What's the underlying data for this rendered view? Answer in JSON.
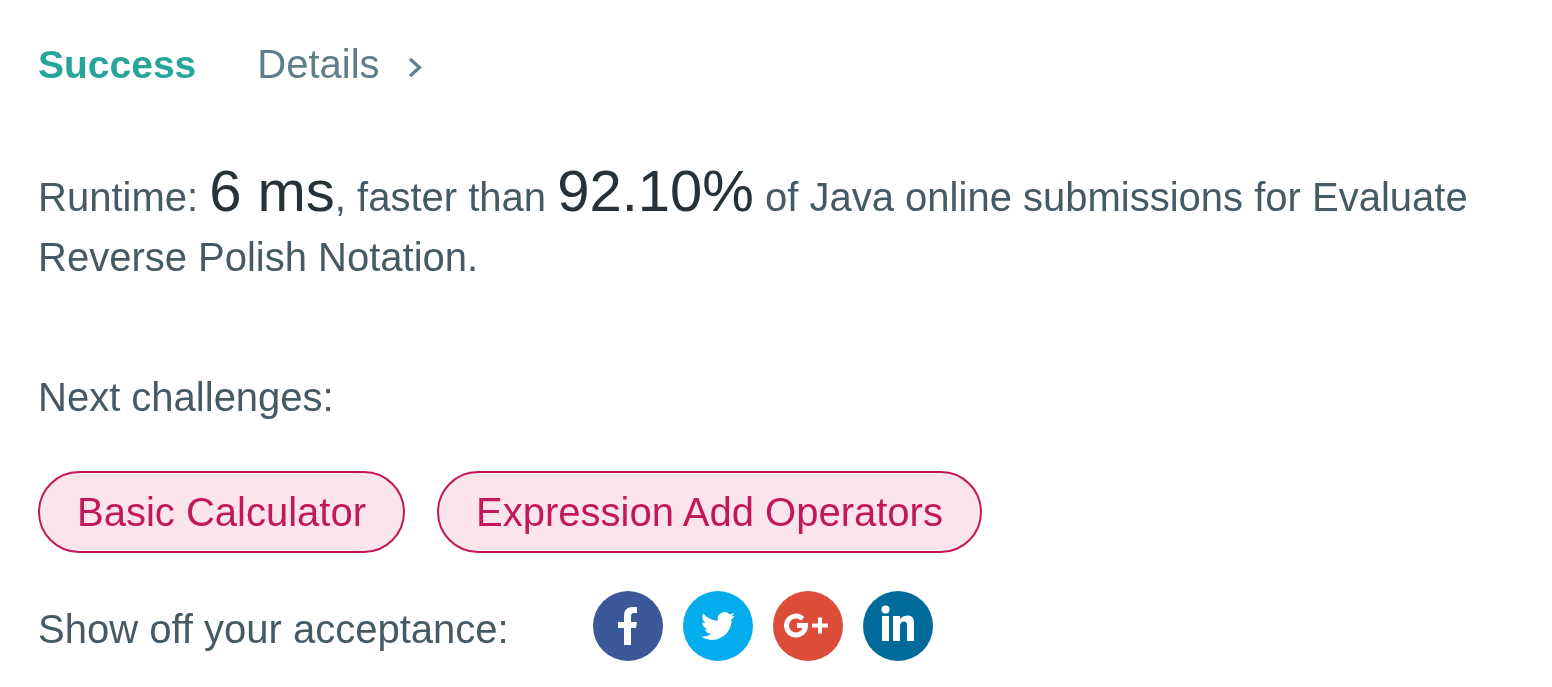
{
  "result": {
    "status": "Success",
    "details_link": "Details"
  },
  "summary": [
    {
      "kind": "text",
      "text": "Runtime: "
    },
    {
      "kind": "figure",
      "text": "6 ms"
    },
    {
      "kind": "text",
      "text": ", faster than "
    },
    {
      "kind": "figure",
      "text": "92.10%"
    },
    {
      "kind": "text",
      "text": " of Java online submissions for Evaluate Reverse Polish Notation."
    }
  ],
  "next_challenges": {
    "heading": "Next challenges:",
    "items": [
      "Basic Calculator",
      "Expression Add Operators"
    ]
  },
  "share": {
    "label": "Show off your acceptance:"
  }
}
